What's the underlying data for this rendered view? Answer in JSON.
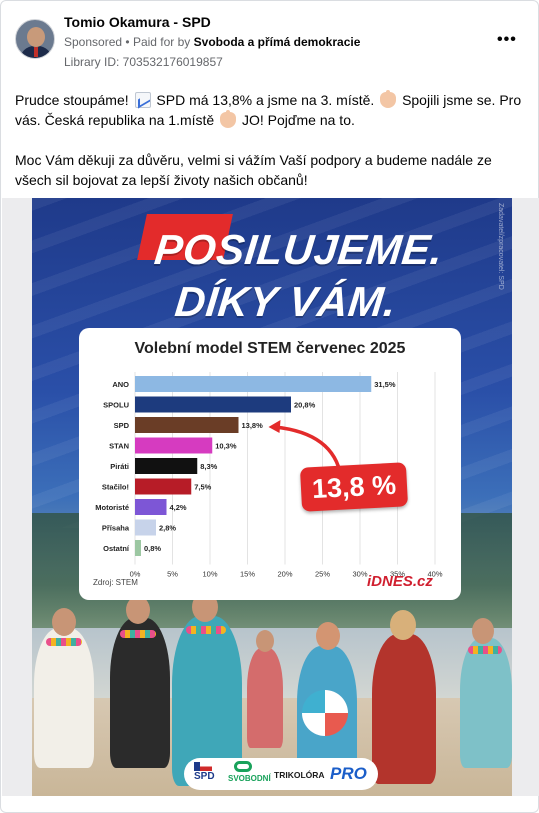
{
  "post": {
    "author": "Tomio Okamura - SPD",
    "sponsored": "Sponsored",
    "paid_prefix": "Paid for by",
    "payer": "Svoboda a přímá demokracie",
    "library_id": "Library ID: 703532176019857",
    "more_icon": "more-options-icon",
    "text_para1_a": "Prudce stoupáme!",
    "text_para1_b": "SPD má 13,8% a jsme na 3. místě.",
    "text_para1_c": "Spojili jsme se. Pro vás. Česká republika na 1.místě",
    "text_para1_d": "JO! Pojďme na to.",
    "text_para2": "Moc Vám děkuji za důvěru, velmi si vážím Vaší podpory a budeme nadále ze všech sil bojovat za lepší životy našich občanů!"
  },
  "poster": {
    "headline_line1": "POSILUJEME.",
    "headline_line2": "DÍKY VÁM.",
    "side_note": "Zadavatel/zpracovatel: SPD",
    "callout": "13,8 %",
    "source": "Zdroj: STEM",
    "brand": "iDNES.cz",
    "logos": {
      "spd": "SPD",
      "svobodni": "SVOBODNÍ",
      "trikolora": "TRIKOLÓRA",
      "pro": "PRO"
    }
  },
  "chart_data": {
    "type": "bar",
    "orientation": "horizontal",
    "title": "Volební model STEM červenec 2025",
    "categories": [
      "ANO",
      "SPOLU",
      "SPD",
      "STAN",
      "Piráti",
      "Stačilo!",
      "Motoristé",
      "Přísaha",
      "Ostatní"
    ],
    "values": [
      31.5,
      20.8,
      13.8,
      10.3,
      8.3,
      7.5,
      4.2,
      2.8,
      0.8
    ],
    "value_labels": [
      "31,5%",
      "20,8%",
      "13,8%",
      "10,3%",
      "8,3%",
      "7,5%",
      "4,2%",
      "2,8%",
      "0,8%"
    ],
    "colors": [
      "#8db8e3",
      "#1d3b7e",
      "#6a3d26",
      "#d63bc0",
      "#111111",
      "#b71c27",
      "#7d56d6",
      "#c7d3ea",
      "#9cc7a2"
    ],
    "xlim": [
      0,
      40
    ],
    "xticks": [
      "0%",
      "5%",
      "10%",
      "15%",
      "20%",
      "25%",
      "30%",
      "35%",
      "40%"
    ],
    "grid": true
  }
}
